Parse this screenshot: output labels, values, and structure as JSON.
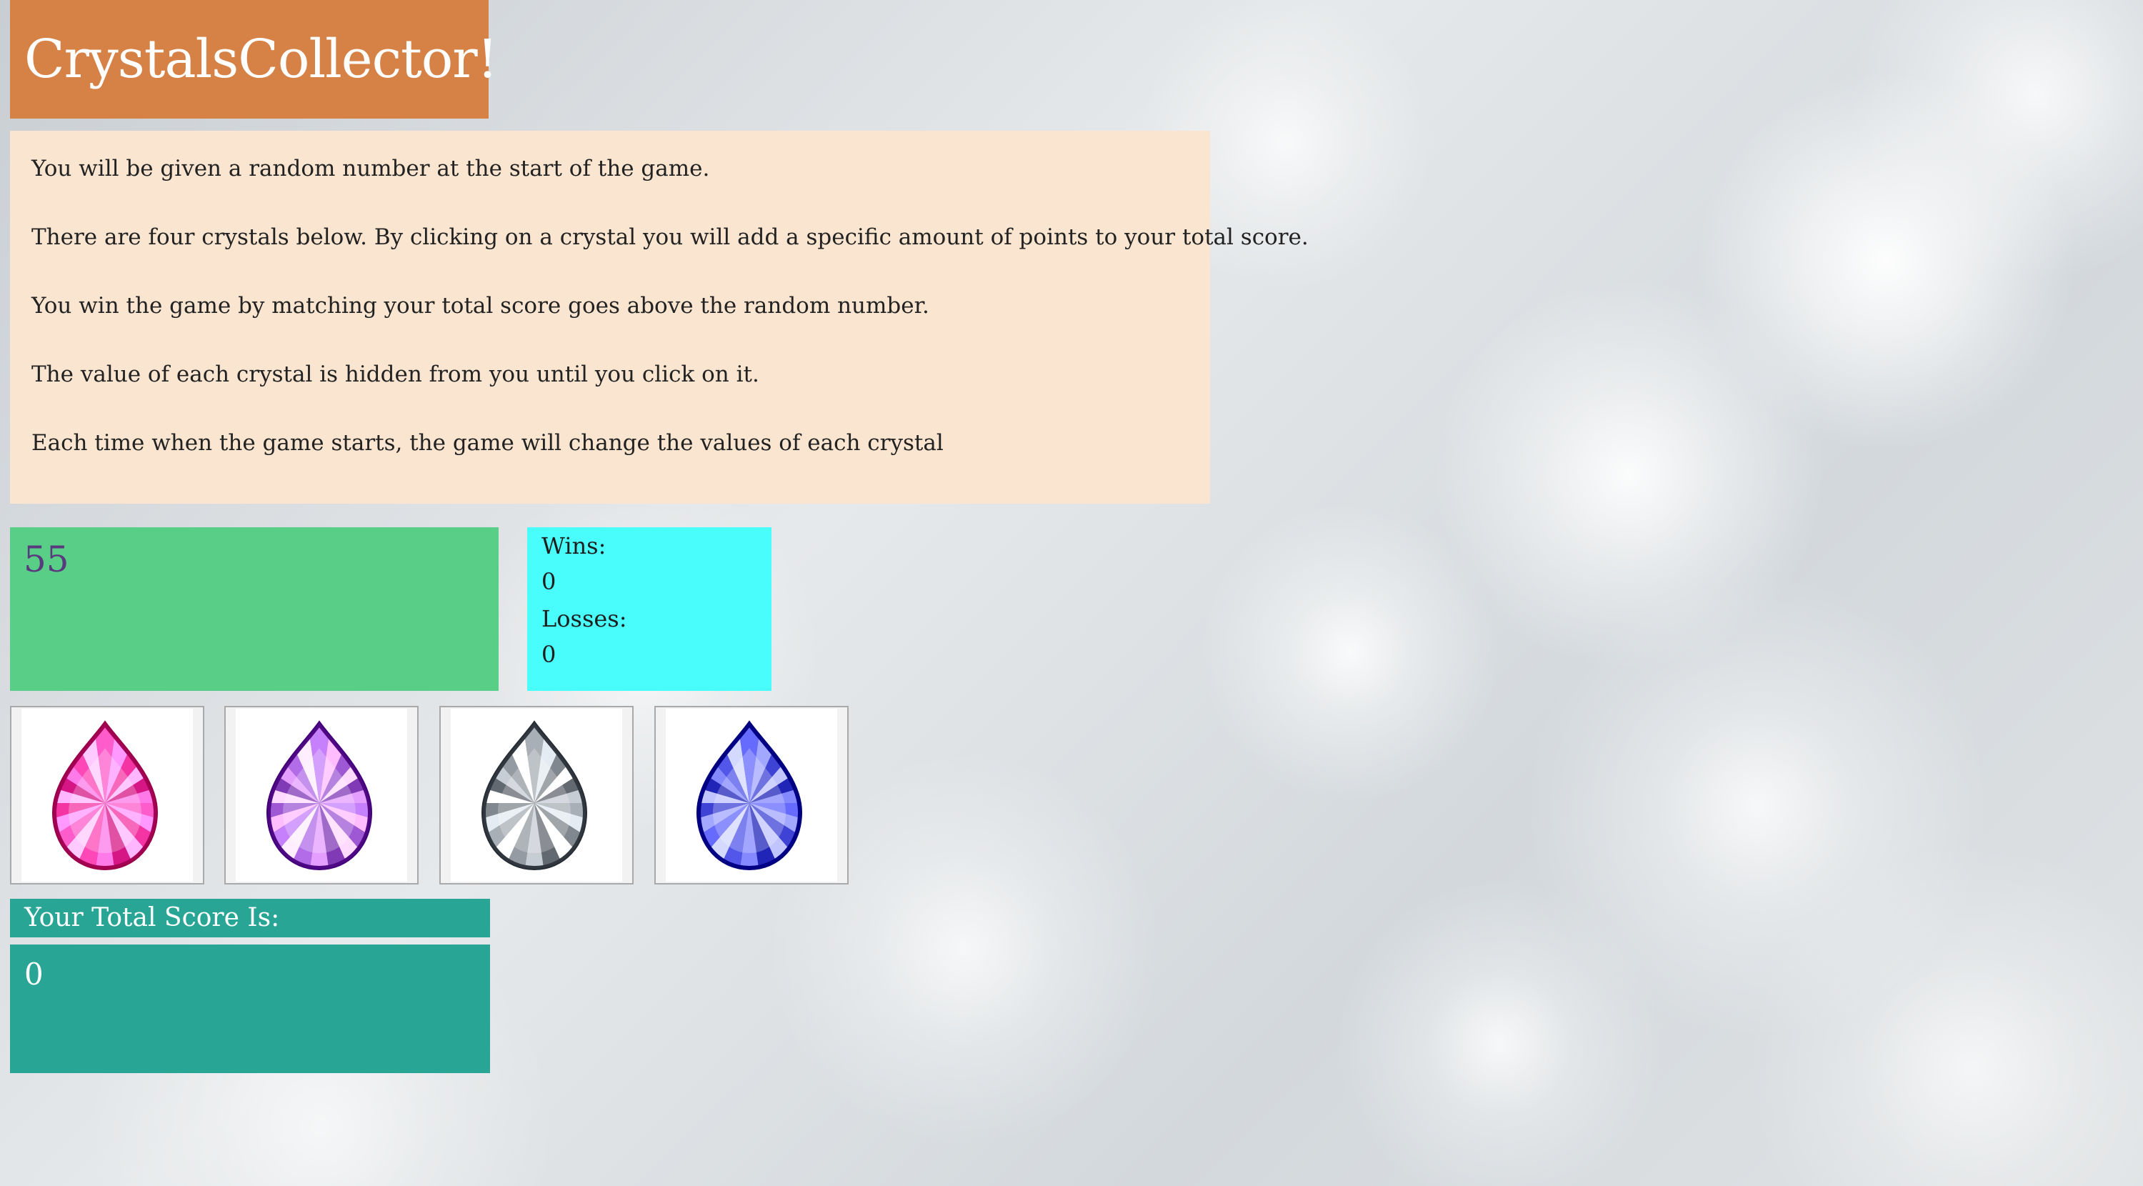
{
  "header": {
    "title": "CrystalsCollector!",
    "color": "#d68246"
  },
  "instructions": {
    "lines": [
      "You will be given a random number at the start of the game.",
      "There are four crystals below. By clicking on a crystal you will add a specific amount of points to your total score.",
      "You win the game by matching your total score goes above the random number.",
      "The value of each crystal is hidden from you until you click on it.",
      "Each time when the game starts, the game will change the values of each crystal"
    ]
  },
  "target": {
    "number": "55",
    "color": "#58ce86"
  },
  "stats": {
    "wins_label": "Wins:",
    "wins_value": "0",
    "losses_label": "Losses:",
    "losses_value": "0",
    "color": "#48fdfb"
  },
  "crystals": [
    {
      "name": "pink-crystal",
      "color": "#e0208f"
    },
    {
      "name": "purple-crystal",
      "color": "#8a44c0"
    },
    {
      "name": "gray-crystal",
      "color": "#6d737a"
    },
    {
      "name": "blue-crystal",
      "color": "#2a2fc2"
    }
  ],
  "score": {
    "label": "Your Total Score Is:",
    "value": "0",
    "color": "#28a595"
  }
}
